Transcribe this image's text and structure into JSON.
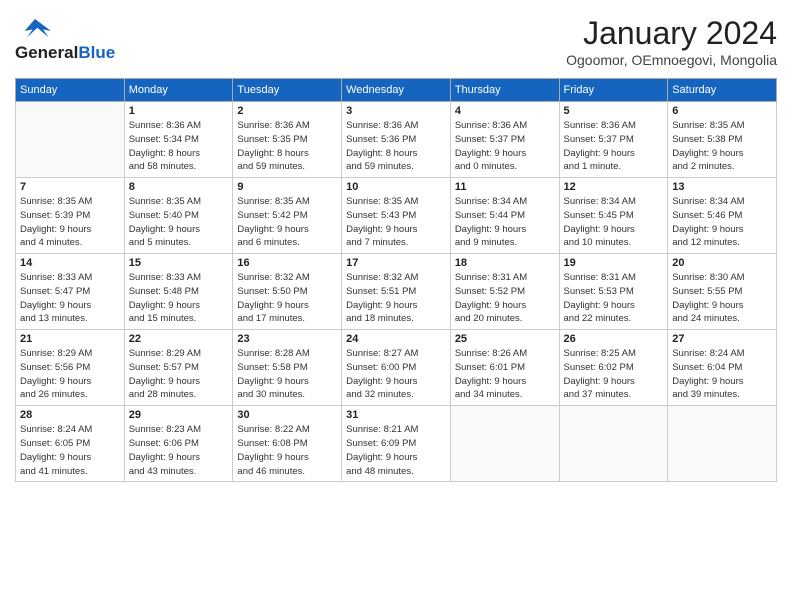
{
  "header": {
    "logo_line1": "General",
    "logo_line2": "Blue",
    "month_title": "January 2024",
    "location": "Ogoomor, OEmnoegovi, Mongolia"
  },
  "days_of_week": [
    "Sunday",
    "Monday",
    "Tuesday",
    "Wednesday",
    "Thursday",
    "Friday",
    "Saturday"
  ],
  "weeks": [
    [
      {
        "day": "",
        "info": ""
      },
      {
        "day": "1",
        "info": "Sunrise: 8:36 AM\nSunset: 5:34 PM\nDaylight: 8 hours\nand 58 minutes."
      },
      {
        "day": "2",
        "info": "Sunrise: 8:36 AM\nSunset: 5:35 PM\nDaylight: 8 hours\nand 59 minutes."
      },
      {
        "day": "3",
        "info": "Sunrise: 8:36 AM\nSunset: 5:36 PM\nDaylight: 8 hours\nand 59 minutes."
      },
      {
        "day": "4",
        "info": "Sunrise: 8:36 AM\nSunset: 5:37 PM\nDaylight: 9 hours\nand 0 minutes."
      },
      {
        "day": "5",
        "info": "Sunrise: 8:36 AM\nSunset: 5:37 PM\nDaylight: 9 hours\nand 1 minute."
      },
      {
        "day": "6",
        "info": "Sunrise: 8:35 AM\nSunset: 5:38 PM\nDaylight: 9 hours\nand 2 minutes."
      }
    ],
    [
      {
        "day": "7",
        "info": "Sunrise: 8:35 AM\nSunset: 5:39 PM\nDaylight: 9 hours\nand 4 minutes."
      },
      {
        "day": "8",
        "info": "Sunrise: 8:35 AM\nSunset: 5:40 PM\nDaylight: 9 hours\nand 5 minutes."
      },
      {
        "day": "9",
        "info": "Sunrise: 8:35 AM\nSunset: 5:42 PM\nDaylight: 9 hours\nand 6 minutes."
      },
      {
        "day": "10",
        "info": "Sunrise: 8:35 AM\nSunset: 5:43 PM\nDaylight: 9 hours\nand 7 minutes."
      },
      {
        "day": "11",
        "info": "Sunrise: 8:34 AM\nSunset: 5:44 PM\nDaylight: 9 hours\nand 9 minutes."
      },
      {
        "day": "12",
        "info": "Sunrise: 8:34 AM\nSunset: 5:45 PM\nDaylight: 9 hours\nand 10 minutes."
      },
      {
        "day": "13",
        "info": "Sunrise: 8:34 AM\nSunset: 5:46 PM\nDaylight: 9 hours\nand 12 minutes."
      }
    ],
    [
      {
        "day": "14",
        "info": "Sunrise: 8:33 AM\nSunset: 5:47 PM\nDaylight: 9 hours\nand 13 minutes."
      },
      {
        "day": "15",
        "info": "Sunrise: 8:33 AM\nSunset: 5:48 PM\nDaylight: 9 hours\nand 15 minutes."
      },
      {
        "day": "16",
        "info": "Sunrise: 8:32 AM\nSunset: 5:50 PM\nDaylight: 9 hours\nand 17 minutes."
      },
      {
        "day": "17",
        "info": "Sunrise: 8:32 AM\nSunset: 5:51 PM\nDaylight: 9 hours\nand 18 minutes."
      },
      {
        "day": "18",
        "info": "Sunrise: 8:31 AM\nSunset: 5:52 PM\nDaylight: 9 hours\nand 20 minutes."
      },
      {
        "day": "19",
        "info": "Sunrise: 8:31 AM\nSunset: 5:53 PM\nDaylight: 9 hours\nand 22 minutes."
      },
      {
        "day": "20",
        "info": "Sunrise: 8:30 AM\nSunset: 5:55 PM\nDaylight: 9 hours\nand 24 minutes."
      }
    ],
    [
      {
        "day": "21",
        "info": "Sunrise: 8:29 AM\nSunset: 5:56 PM\nDaylight: 9 hours\nand 26 minutes."
      },
      {
        "day": "22",
        "info": "Sunrise: 8:29 AM\nSunset: 5:57 PM\nDaylight: 9 hours\nand 28 minutes."
      },
      {
        "day": "23",
        "info": "Sunrise: 8:28 AM\nSunset: 5:58 PM\nDaylight: 9 hours\nand 30 minutes."
      },
      {
        "day": "24",
        "info": "Sunrise: 8:27 AM\nSunset: 6:00 PM\nDaylight: 9 hours\nand 32 minutes."
      },
      {
        "day": "25",
        "info": "Sunrise: 8:26 AM\nSunset: 6:01 PM\nDaylight: 9 hours\nand 34 minutes."
      },
      {
        "day": "26",
        "info": "Sunrise: 8:25 AM\nSunset: 6:02 PM\nDaylight: 9 hours\nand 37 minutes."
      },
      {
        "day": "27",
        "info": "Sunrise: 8:24 AM\nSunset: 6:04 PM\nDaylight: 9 hours\nand 39 minutes."
      }
    ],
    [
      {
        "day": "28",
        "info": "Sunrise: 8:24 AM\nSunset: 6:05 PM\nDaylight: 9 hours\nand 41 minutes."
      },
      {
        "day": "29",
        "info": "Sunrise: 8:23 AM\nSunset: 6:06 PM\nDaylight: 9 hours\nand 43 minutes."
      },
      {
        "day": "30",
        "info": "Sunrise: 8:22 AM\nSunset: 6:08 PM\nDaylight: 9 hours\nand 46 minutes."
      },
      {
        "day": "31",
        "info": "Sunrise: 8:21 AM\nSunset: 6:09 PM\nDaylight: 9 hours\nand 48 minutes."
      },
      {
        "day": "",
        "info": ""
      },
      {
        "day": "",
        "info": ""
      },
      {
        "day": "",
        "info": ""
      }
    ]
  ]
}
